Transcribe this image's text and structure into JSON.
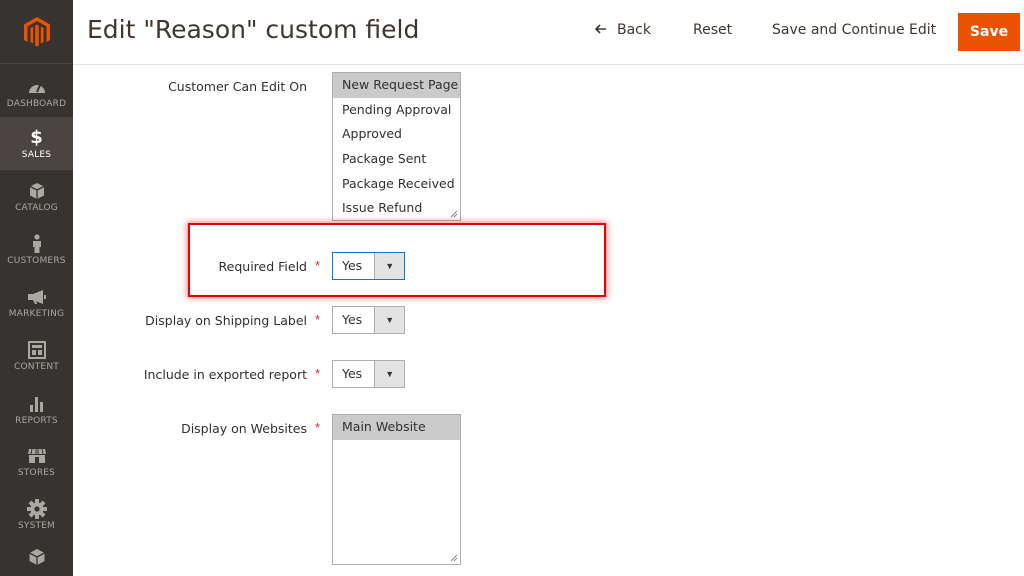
{
  "colors": {
    "sidebar": "#373330",
    "accent": "#eb5202",
    "required": "#e22626",
    "highlight": "#e60000"
  },
  "sidebar": {
    "logo_icon": "magento-logo-icon",
    "items": [
      {
        "label": "DASHBOARD",
        "icon": "speedometer-icon"
      },
      {
        "label": "SALES",
        "icon": "dollar-icon"
      },
      {
        "label": "CATALOG",
        "icon": "box-icon"
      },
      {
        "label": "CUSTOMERS",
        "icon": "person-icon"
      },
      {
        "label": "MARKETING",
        "icon": "megaphone-icon"
      },
      {
        "label": "CONTENT",
        "icon": "layout-icon"
      },
      {
        "label": "REPORTS",
        "icon": "bar-chart-icon"
      },
      {
        "label": "STORES",
        "icon": "storefront-icon"
      },
      {
        "label": "SYSTEM",
        "icon": "gear-icon"
      },
      {
        "label": "",
        "icon": "cube-icon"
      }
    ]
  },
  "header": {
    "title": "Edit \"Reason\" custom field",
    "back_label": "Back",
    "back_icon": "arrow-left-icon",
    "reset_label": "Reset",
    "save_continue_label": "Save and Continue Edit",
    "save_label": "Save"
  },
  "form": {
    "customer_can_edit": {
      "label": "Customer Can Edit On",
      "options": [
        "New Request Page",
        "Pending Approval",
        "Approved",
        "Package Sent",
        "Package Received",
        "Issue Refund"
      ],
      "selected": "New Request Page"
    },
    "required_field": {
      "label": "Required Field",
      "required_mark": "*",
      "value": "Yes",
      "arrow": "▼"
    },
    "shipping_label": {
      "label": "Display on Shipping Label",
      "required_mark": "*",
      "value": "Yes",
      "arrow": "▼"
    },
    "exported_report": {
      "label": "Include in exported report",
      "required_mark": "*",
      "value": "Yes",
      "arrow": "▼"
    },
    "websites": {
      "label": "Display on Websites",
      "required_mark": "*",
      "options": [
        "Main Website"
      ],
      "selected": "Main Website"
    }
  }
}
